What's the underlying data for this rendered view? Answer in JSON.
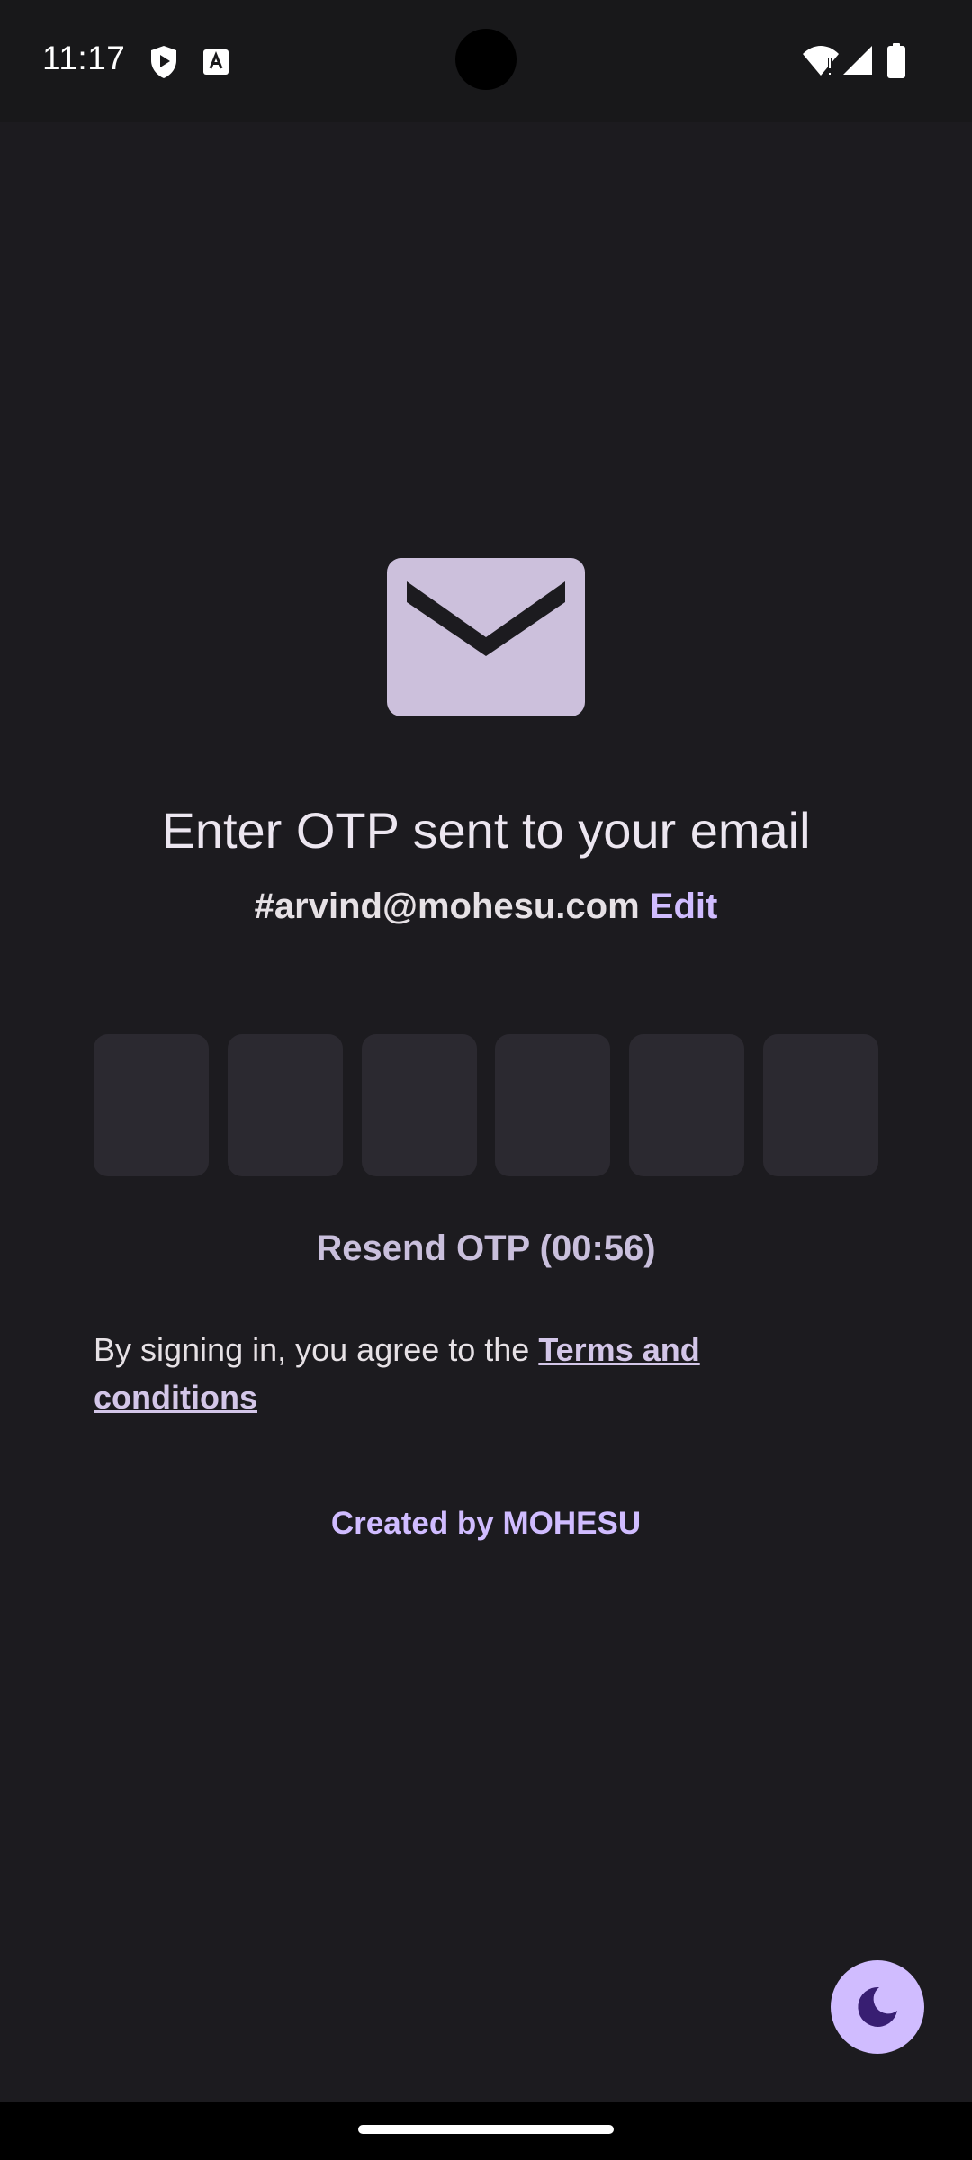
{
  "status_bar": {
    "time": "11:17",
    "icons": [
      "shield-play-icon",
      "text-a-icon",
      "wifi-alert-icon",
      "cell-signal-icon",
      "battery-icon"
    ]
  },
  "main": {
    "icon": "mail-icon",
    "title": "Enter OTP sent to your email",
    "email": "#arvind@mohesu.com",
    "edit_label": "Edit",
    "otp_digits": [
      "",
      "",
      "",
      "",
      "",
      ""
    ],
    "resend_label": "Resend OTP (00:56)",
    "terms_prefix": "By signing in, you agree to the ",
    "terms_link": "Terms and conditions",
    "credit": "Created by MOHESU"
  },
  "fab": {
    "icon": "moon-icon"
  },
  "colors": {
    "background": "#1c1b1f",
    "accent": "#d0bcff",
    "otp_box": "#2b2930",
    "envelope": "#ccc0dc"
  }
}
